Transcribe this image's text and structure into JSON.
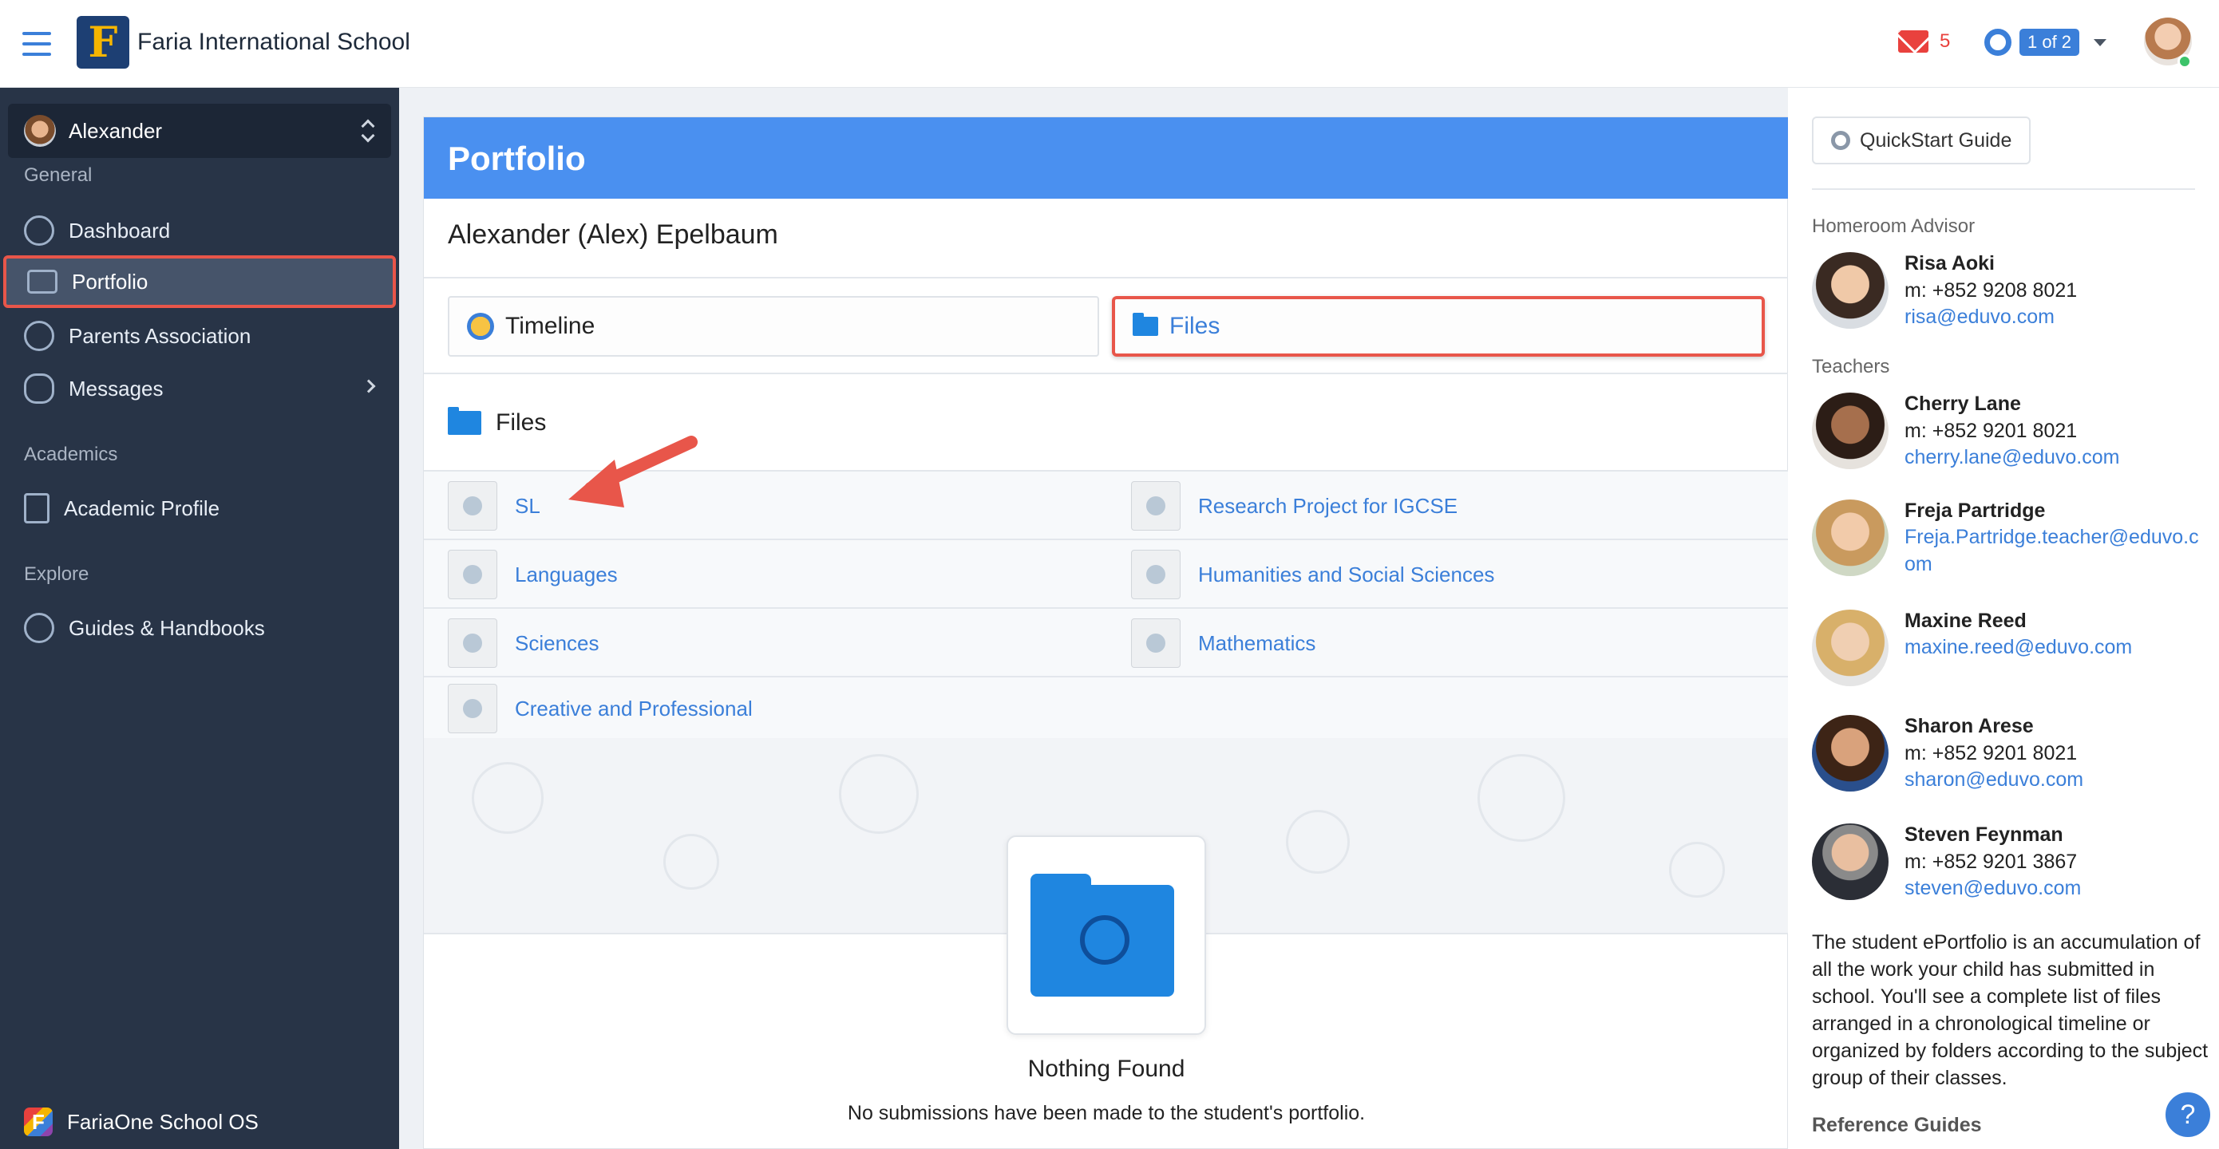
{
  "topbar": {
    "school_name": "Faria International School",
    "mail_count": "5",
    "pager_label": "1 of 2"
  },
  "sidebar": {
    "user_name": "Alexander",
    "sections": {
      "general": "General",
      "academics": "Academics",
      "explore": "Explore"
    },
    "items": [
      {
        "label": "Dashboard",
        "icon": "clock-icon"
      },
      {
        "label": "Portfolio",
        "icon": "briefcase-icon",
        "active": true
      },
      {
        "label": "Parents Association",
        "icon": "people-icon"
      },
      {
        "label": "Messages",
        "icon": "chat-icon"
      },
      {
        "label": "Academic Profile",
        "icon": "document-icon"
      },
      {
        "label": "Guides & Handbooks",
        "icon": "handbook-icon"
      }
    ],
    "bottom_app": "FariaOne School OS"
  },
  "main": {
    "title": "Portfolio",
    "student_name": "Alexander (Alex) Epelbaum",
    "tabs": [
      {
        "label": "Timeline",
        "icon": "timeline-clock-icon"
      },
      {
        "label": "Files",
        "icon": "folder-icon",
        "active": true
      }
    ],
    "files_heading": "Files",
    "folders": [
      {
        "name": "SL"
      },
      {
        "name": "Research Project for IGCSE"
      },
      {
        "name": "Languages"
      },
      {
        "name": "Humanities and Social Sciences"
      },
      {
        "name": "Sciences"
      },
      {
        "name": "Mathematics"
      },
      {
        "name": "Creative and Professional"
      }
    ],
    "empty_title": "Nothing Found",
    "empty_subtitle": "No submissions have been made to the student's portfolio."
  },
  "right": {
    "quickstart_label": "QuickStart Guide",
    "homeroom_label": "Homeroom Advisor",
    "homeroom": {
      "name": "Risa Aoki",
      "phone": "m: +852 9208 8021",
      "email": "risa@eduvo.com"
    },
    "teachers_label": "Teachers",
    "teachers": [
      {
        "name": "Cherry Lane",
        "phone": "m: +852 9201 8021",
        "email": "cherry.lane@eduvo.com"
      },
      {
        "name": "Freja Partridge",
        "phone": "",
        "email": "Freja.Partridge.teacher@eduvo.com"
      },
      {
        "name": "Maxine Reed",
        "phone": "",
        "email": "maxine.reed@eduvo.com"
      },
      {
        "name": "Sharon Arese",
        "phone": "m: +852 9201 8021",
        "email": "sharon@eduvo.com"
      },
      {
        "name": "Steven Feynman",
        "phone": "m: +852 9201 3867",
        "email": "steven@eduvo.com"
      }
    ],
    "description": "The student ePortfolio is an accumulation of all the work your child has submitted in school. You'll see a complete list of files arranged in a chronological timeline or organized by folders according to the subject group of their classes.",
    "reference_guides": "Reference Guides"
  },
  "colors": {
    "accent": "#3b7fd9",
    "header_blue": "#4a90f0",
    "sidebar_bg": "#283447",
    "highlight_red": "#e8564a"
  }
}
